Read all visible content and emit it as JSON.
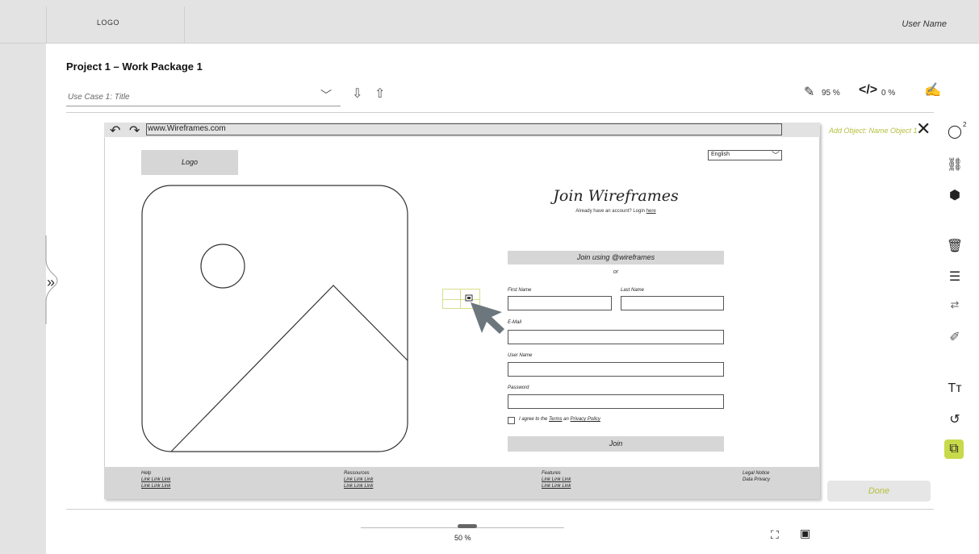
{
  "header": {
    "logo": "LOGO",
    "user_name": "User Name"
  },
  "project": {
    "title": "Project 1 – Work Package 1",
    "use_case": "Use Case 1: Title"
  },
  "stats": {
    "pencil_pct": "95 %",
    "code_pct": "0 %"
  },
  "browser": {
    "url": "www.Wireframes.com"
  },
  "wireframe": {
    "logo": "Logo",
    "language": "English",
    "join_title": "Join Wireframes",
    "join_sub_prefix": "Already have an account? Login",
    "join_sub_link": "here",
    "join_using": "Join using @wireframes",
    "or": "or",
    "first_name": "First Name",
    "last_name": "Last Name",
    "email": "E-Mail",
    "user_name": "User Name",
    "password": "Password",
    "agree_prefix": "I agree to the",
    "agree_terms": "Terms",
    "agree_mid": "an",
    "agree_privacy": "Privacy Policy",
    "join_button": "Join",
    "footer": [
      {
        "title": "Help",
        "line1": "Link Link Link",
        "line2": "Link Link Link"
      },
      {
        "title": "Ressources",
        "line1": "Link Link Link",
        "line2": "Link Link Link"
      },
      {
        "title": "Features",
        "line1": "Link Link Link",
        "line2": "Link Link Link"
      },
      {
        "title": "Legal Notice",
        "line1": "Data Privacy",
        "line2": ""
      }
    ]
  },
  "side_panel": {
    "add_object": "Add Object: Name Object 1",
    "done": "Done"
  },
  "toolbar": {
    "comment_count": "2"
  },
  "bottom": {
    "zoom": "50 %"
  },
  "icons": [
    "undo-icon",
    "redo-icon",
    "download-icon",
    "upload-icon",
    "pencil-icon",
    "code-icon",
    "sign-icon",
    "close-icon",
    "comment-icon",
    "link-icon",
    "cube-icon",
    "trash-icon",
    "list-icon",
    "swap-icon",
    "brush-icon",
    "text-icon",
    "history-icon",
    "layers-icon",
    "fullscreen-icon",
    "calendar-icon",
    "expand-icon"
  ],
  "colors": {
    "accent": "#b5bf3c",
    "active_tool": "#c8d94a",
    "chrome": "#e3e3e3",
    "wire_fill": "#d6d6d6"
  }
}
